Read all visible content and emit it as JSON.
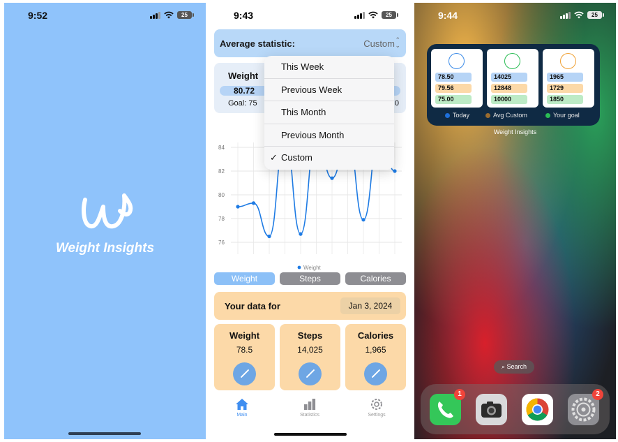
{
  "splash": {
    "time": "9:52",
    "battery": "25",
    "logo_letter": "W",
    "app_name": "Weight Insights"
  },
  "main": {
    "time": "9:43",
    "battery": "25",
    "avg_label": "Average statistic:",
    "avg_value": "Custom",
    "stat_title": "Weight",
    "stat_value": "80.72",
    "goal_text": "Goal: 75",
    "goal_text_2": "0",
    "dropdown": [
      {
        "label": "This Week",
        "checked": false
      },
      {
        "label": "Previous Week",
        "checked": false
      },
      {
        "label": "This Month",
        "checked": false
      },
      {
        "label": "Previous Month",
        "checked": false
      },
      {
        "label": "Custom",
        "checked": true
      }
    ],
    "check_mark": "✓",
    "segments": [
      "Weight",
      "Steps",
      "Calories"
    ],
    "selected_segment": "Weight",
    "data_for_label": "Your data for",
    "date": "Jan 3, 2024",
    "tiles": [
      {
        "title": "Weight",
        "value": "78.5"
      },
      {
        "title": "Steps",
        "value": "14,025"
      },
      {
        "title": "Calories",
        "value": "1,965"
      }
    ],
    "tabs": [
      "Main",
      "Statistics",
      "Settings"
    ],
    "active_tab": "Main",
    "colors": {
      "accent": "#3f8ef0",
      "card": "#fcd9a8",
      "header": "#b8d8f8"
    }
  },
  "chart_data": {
    "type": "line",
    "ylim": [
      75,
      85
    ],
    "yticks": [
      76,
      78,
      80,
      82,
      84
    ],
    "series": [
      {
        "name": "Weight",
        "values": [
          79.0,
          79.3,
          76.5,
          85,
          76.7,
          85,
          81.4,
          85,
          77.9,
          85,
          82.0
        ]
      }
    ],
    "legend": "bottom",
    "grid": true
  },
  "home": {
    "time": "9:44",
    "battery": "25",
    "widget": {
      "columns": [
        {
          "icon": "scale-icon",
          "rows": [
            "78.50",
            "79.56",
            "75.00"
          ]
        },
        {
          "icon": "walking-icon",
          "rows": [
            "14025",
            "12848",
            "10000"
          ]
        },
        {
          "icon": "flame-icon",
          "rows": [
            "1965",
            "1729",
            "1850"
          ]
        }
      ],
      "legend": [
        {
          "label": "Today",
          "color": "#1e6fd9"
        },
        {
          "label": "Avg Custom",
          "color": "#9a6b2e"
        },
        {
          "label": "Your goal",
          "color": "#2bbd55"
        }
      ],
      "name": "Weight Insights"
    },
    "search": "Search",
    "dock": [
      {
        "name": "Phone",
        "badge": "1"
      },
      {
        "name": "Camera",
        "badge": ""
      },
      {
        "name": "Chrome",
        "badge": ""
      },
      {
        "name": "Settings",
        "badge": "2"
      }
    ]
  }
}
